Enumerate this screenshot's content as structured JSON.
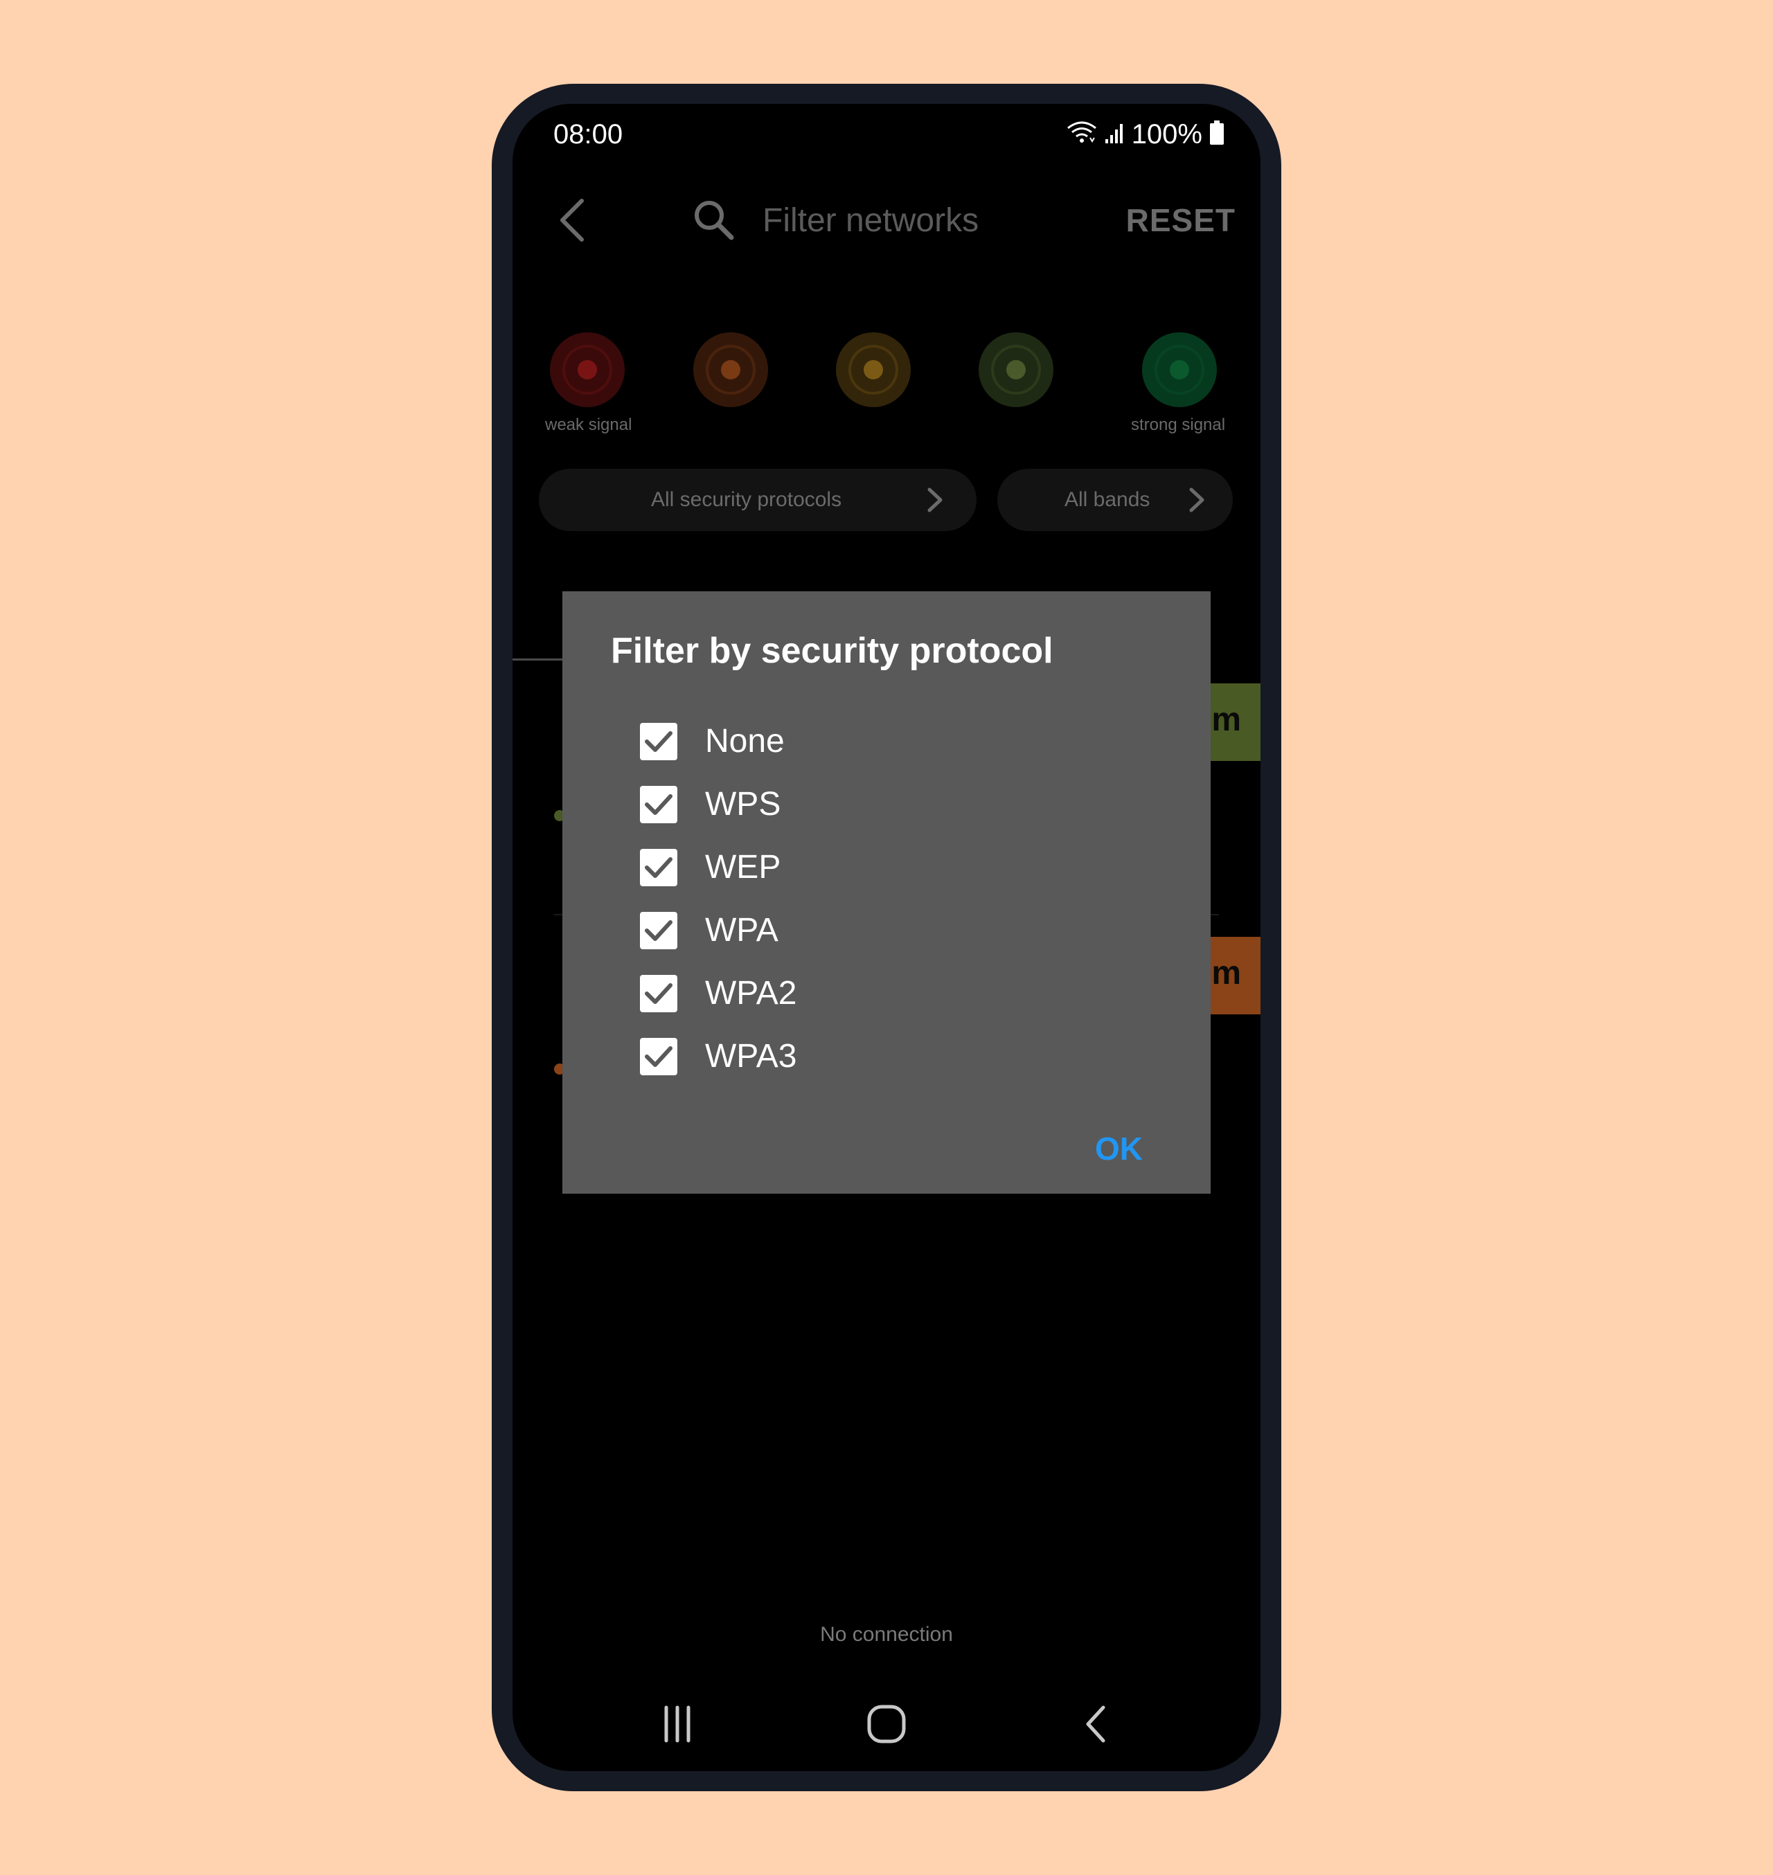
{
  "status_bar": {
    "time": "08:00",
    "battery": "100%",
    "icons": [
      "wifi-icon",
      "signal-bars-icon",
      "battery-icon"
    ]
  },
  "toolbar": {
    "back_icon": "back-arrow-icon",
    "search_icon": "search-icon",
    "search_placeholder": "Filter networks",
    "reset_label": "RESET"
  },
  "signal_filter": {
    "weak_label": "weak signal",
    "strong_label": "strong signal",
    "levels": [
      {
        "color": "#3a0a0a",
        "core": "#7a1414"
      },
      {
        "color": "#33180a",
        "core": "#7a3a14"
      },
      {
        "color": "#33250a",
        "core": "#7a5a14"
      },
      {
        "color": "#1f2a14",
        "core": "#4a5a2a"
      },
      {
        "color": "#063a1e",
        "core": "#0a5a2e"
      }
    ]
  },
  "chips": {
    "security": "All security protocols",
    "bands": "All bands"
  },
  "background_list": {
    "row1_color": "#4a5a24",
    "row2_color": "#8a4418",
    "strip_text": "m"
  },
  "dialog": {
    "title": "Filter by security protocol",
    "options": [
      {
        "label": "None",
        "checked": true
      },
      {
        "label": "WPS",
        "checked": true
      },
      {
        "label": "WEP",
        "checked": true
      },
      {
        "label": "WPA",
        "checked": true
      },
      {
        "label": "WPA2",
        "checked": true
      },
      {
        "label": "WPA3",
        "checked": true
      }
    ],
    "ok_label": "OK",
    "accent_color": "#2196f3"
  },
  "footer": {
    "status_text": "No connection"
  },
  "nav_bar": {
    "icons": [
      "recent-apps-icon",
      "home-icon",
      "back-icon"
    ]
  }
}
